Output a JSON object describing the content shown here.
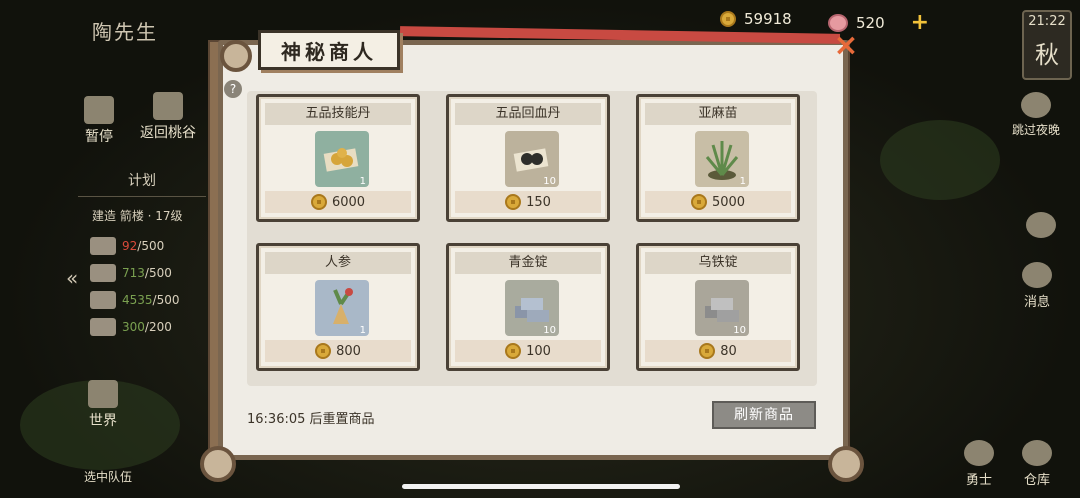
{
  "top": {
    "city_name": "陶先生",
    "coins": "59918",
    "gems": "520",
    "plus": "+"
  },
  "clock": {
    "time": "21:22",
    "season": "秋"
  },
  "left_menu": {
    "pause": "暂停",
    "back": "返回桃谷"
  },
  "plan": {
    "title": "计划",
    "subtitle": "建造 箭楼 · 17级",
    "rows": [
      {
        "have": "92",
        "need": "/500",
        "status": "bad"
      },
      {
        "have": "713",
        "need": "/500",
        "status": "good"
      },
      {
        "have": "4535",
        "need": "/500",
        "status": "good"
      },
      {
        "have": "300",
        "need": "/200",
        "status": "good"
      }
    ]
  },
  "bottom_left": {
    "world": "世界",
    "team": "选中队伍"
  },
  "right_menu": {
    "skip_night": "跳过夜晚",
    "messages": "消息",
    "warrior": "勇士",
    "warehouse": "仓库"
  },
  "shop": {
    "title": "神秘商人",
    "close": "×",
    "help": "?",
    "items": [
      {
        "name": "五品技能丹",
        "qty": "1",
        "price": "6000",
        "icon": "pill-icon"
      },
      {
        "name": "五品回血丹",
        "qty": "10",
        "price": "150",
        "icon": "pill-icon"
      },
      {
        "name": "亚麻苗",
        "qty": "1",
        "price": "5000",
        "icon": "sprout-icon"
      },
      {
        "name": "人参",
        "qty": "1",
        "price": "800",
        "icon": "ginseng-icon"
      },
      {
        "name": "青金锭",
        "qty": "10",
        "price": "100",
        "icon": "ingot-icon"
      },
      {
        "name": "乌铁锭",
        "qty": "10",
        "price": "80",
        "icon": "ingot-icon"
      }
    ],
    "reset_text": "16:36:05 后重置商品",
    "refresh_label": "刷新商品"
  }
}
